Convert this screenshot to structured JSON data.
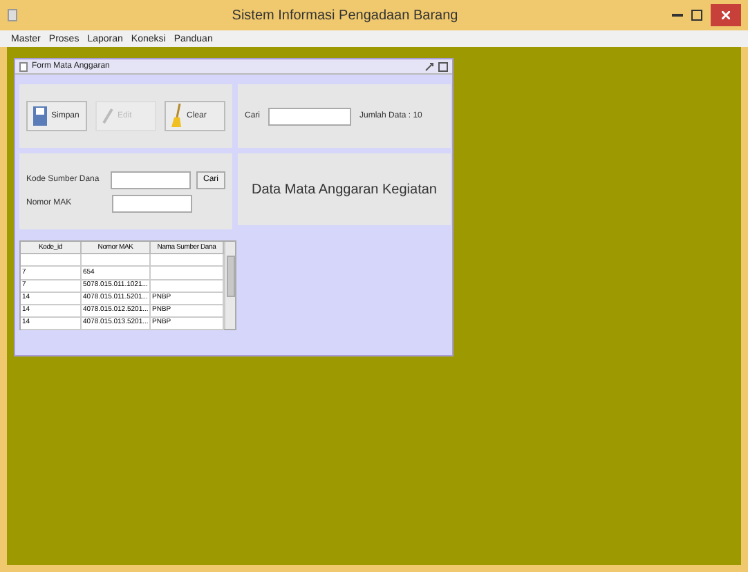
{
  "window": {
    "title": "Sistem Informasi Pengadaan Barang"
  },
  "menu": [
    "Master",
    "Proses",
    "Laporan",
    "Koneksi",
    "Panduan"
  ],
  "frame": {
    "title": "Form Mata Anggaran"
  },
  "buttons": [
    {
      "label": "Simpan",
      "disabled": false,
      "kind": "save"
    },
    {
      "label": "Edit",
      "disabled": true,
      "kind": "edit"
    },
    {
      "label": "Clear",
      "disabled": false,
      "kind": "clear"
    }
  ],
  "search": {
    "label": "Cari",
    "count": "Jumlah Data : 10"
  },
  "form": {
    "fields": [
      {
        "label": "Kode Sumber Dana"
      },
      {
        "label": "Nomor MAK"
      }
    ],
    "button": "Cari"
  },
  "heading": "Data Mata Anggaran Kegiatan",
  "table": {
    "columns": [
      "Kode_id",
      "Nomor MAK",
      "Nama Sumber Dana"
    ],
    "rows": [
      [
        "",
        "",
        ""
      ],
      [
        "7",
        "654",
        ""
      ],
      [
        "7",
        "5078.015.011.1021...",
        ""
      ],
      [
        "14",
        "4078.015.011.5201...",
        "PNBP"
      ],
      [
        "14",
        "4078.015.012.5201...",
        "PNBP"
      ],
      [
        "14",
        "4078.015.013.5201...",
        "PNBP"
      ]
    ]
  }
}
